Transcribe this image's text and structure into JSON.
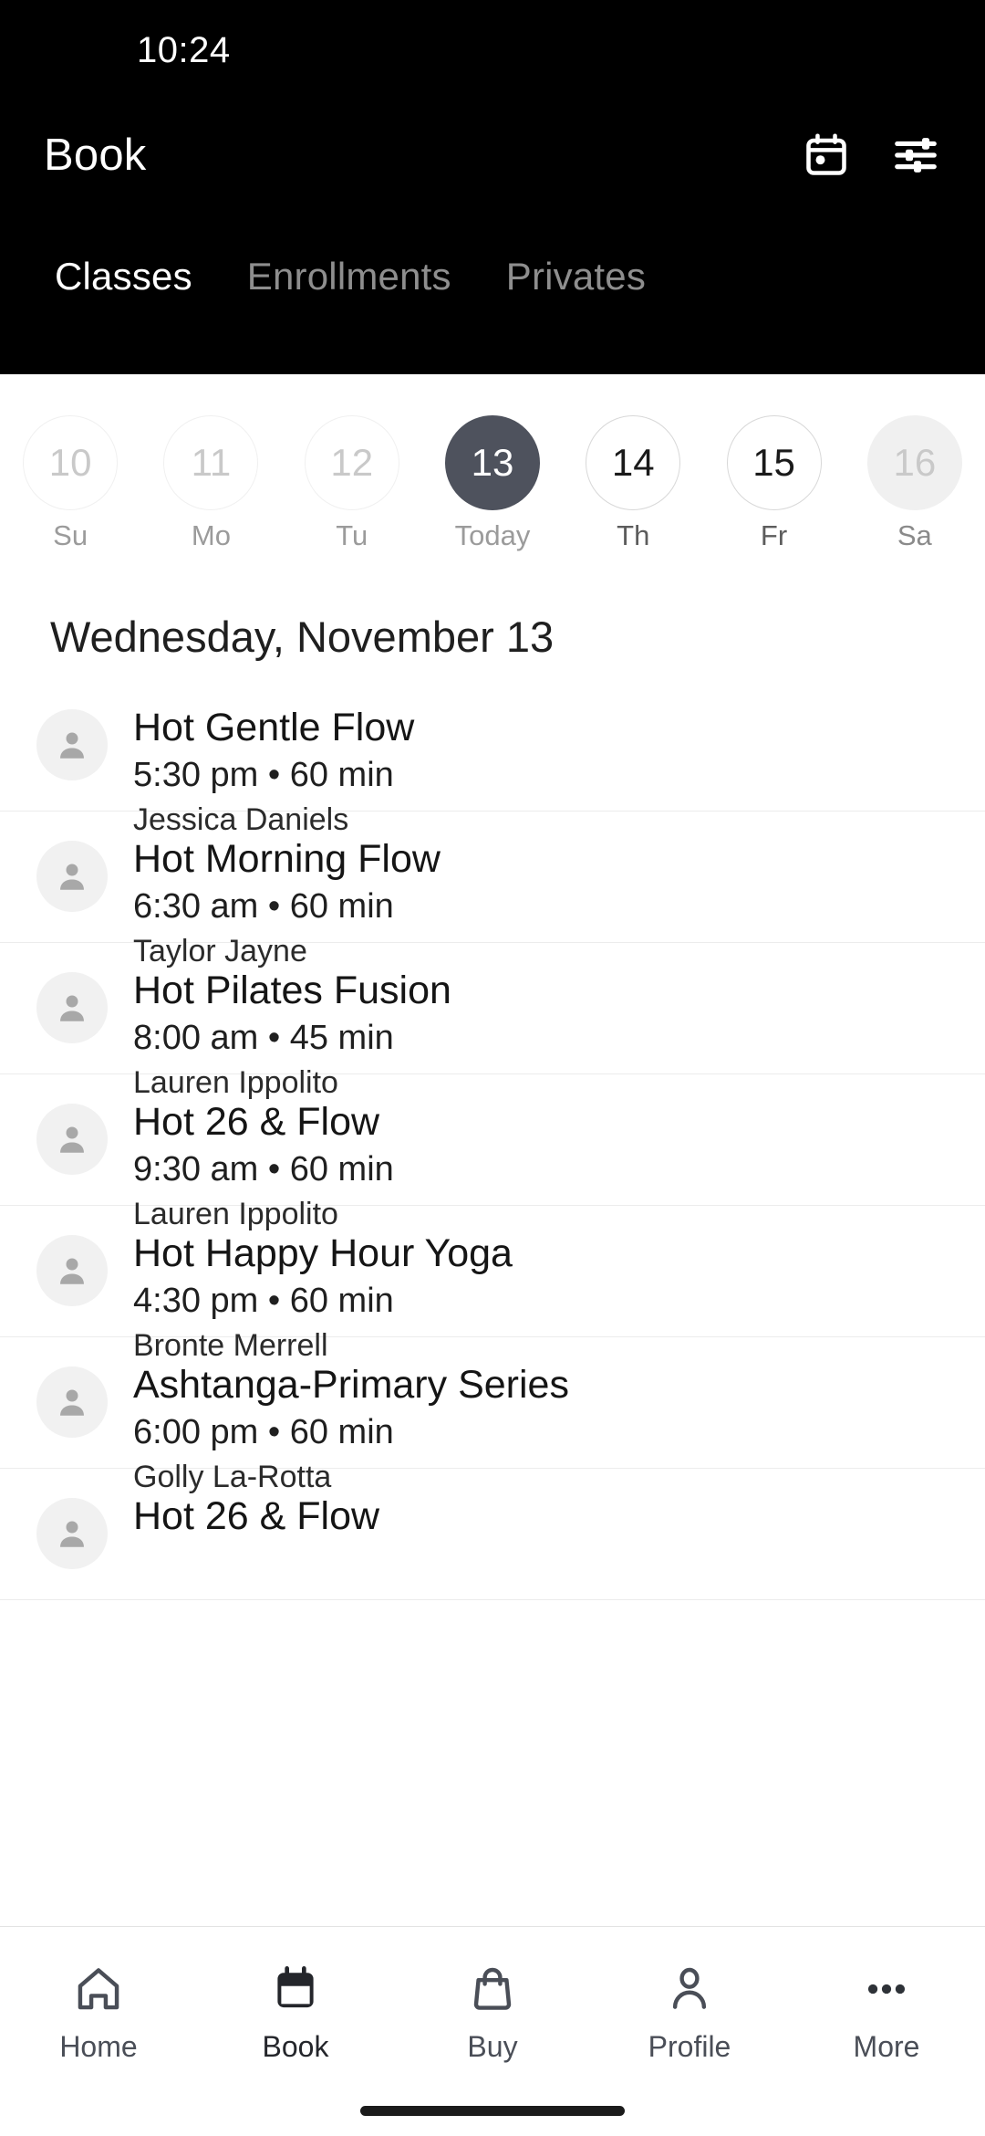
{
  "status_bar": {
    "time": "10:24"
  },
  "header": {
    "title": "Book",
    "actions": [
      {
        "name": "calendar-icon",
        "label": "Calendar"
      },
      {
        "name": "filter-icon",
        "label": "Filters"
      }
    ],
    "tabs": [
      {
        "label": "Classes",
        "active": true
      },
      {
        "label": "Enrollments",
        "active": false
      },
      {
        "label": "Privates",
        "active": false
      }
    ]
  },
  "date_strip": [
    {
      "day_number": "10",
      "weekday": "Su",
      "state": "past"
    },
    {
      "day_number": "11",
      "weekday": "Mo",
      "state": "past"
    },
    {
      "day_number": "12",
      "weekday": "Tu",
      "state": "past"
    },
    {
      "day_number": "13",
      "weekday": "Today",
      "state": "today"
    },
    {
      "day_number": "14",
      "weekday": "Th",
      "state": "future"
    },
    {
      "day_number": "15",
      "weekday": "Fr",
      "state": "future"
    },
    {
      "day_number": "16",
      "weekday": "Sa",
      "state": "pressed"
    }
  ],
  "main": {
    "day_heading": "Wednesday, November 13",
    "classes": [
      {
        "name": "Hot Gentle Flow",
        "meta": "5:30 pm • 60 min",
        "staff": "Jessica Daniels"
      },
      {
        "name": "Hot Morning Flow",
        "meta": "6:30 am • 60 min",
        "staff": "Taylor Jayne"
      },
      {
        "name": "Hot Pilates Fusion",
        "meta": "8:00 am • 45 min",
        "staff": "Lauren Ippolito"
      },
      {
        "name": "Hot 26 & Flow",
        "meta": "9:30 am • 60 min",
        "staff": "Lauren Ippolito"
      },
      {
        "name": "Hot Happy Hour Yoga",
        "meta": "4:30 pm • 60 min",
        "staff": "Bronte Merrell"
      },
      {
        "name": "Ashtanga-Primary Series",
        "meta": "6:00 pm • 60 min",
        "staff": "Golly La-Rotta"
      },
      {
        "name": "Hot 26 & Flow",
        "meta": "",
        "staff": ""
      }
    ]
  },
  "bottom_nav": [
    {
      "label": "Home",
      "icon": "home-icon",
      "active": false
    },
    {
      "label": "Book",
      "icon": "calendar-icon",
      "active": true
    },
    {
      "label": "Buy",
      "icon": "bag-icon",
      "active": false
    },
    {
      "label": "Profile",
      "icon": "person-icon",
      "active": false
    },
    {
      "label": "More",
      "icon": "ellipsis-icon",
      "active": false
    }
  ],
  "colors": {
    "header_bg": "#000000",
    "today_chip": "#4e525d",
    "nav_icon": "#4a4e57",
    "nav_active": "#24262b",
    "divider": "#ececec"
  }
}
